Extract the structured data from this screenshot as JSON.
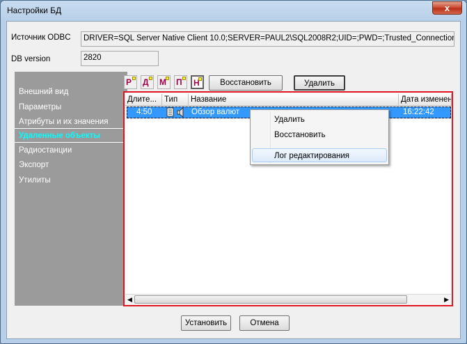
{
  "window": {
    "title": "Настройки БД",
    "close_glyph": "x"
  },
  "odbc": {
    "label": "Источник ODBC",
    "value": "DRIVER=SQL Server Native Client 10.0;SERVER=PAUL2\\SQL2008R2;UID=;PWD=;Trusted_Connection=yes;l"
  },
  "dbversion": {
    "label": "DB version",
    "value": "2820"
  },
  "nav": {
    "items": [
      {
        "label": "Внешний вид"
      },
      {
        "label": "Параметры"
      },
      {
        "label": "Атрибуты и их значения"
      },
      {
        "label": "Удаленные объекты",
        "selected": true
      },
      {
        "label": "Радиостанции"
      },
      {
        "label": "Экспорт"
      },
      {
        "label": "Утилиты"
      }
    ]
  },
  "toolbar": {
    "filters": [
      "Р",
      "Д",
      "М",
      "П",
      "Н"
    ],
    "restore_label": "Восстановить",
    "delete_label": "Удалить"
  },
  "grid": {
    "columns": [
      "Длите...",
      "Тип",
      "Название",
      "Дата изменен"
    ],
    "rows": [
      {
        "duration": "4:50",
        "name": "Обзор валют",
        "date": "16:22:42"
      }
    ]
  },
  "context_menu": {
    "items": [
      "Удалить",
      "Восстановить",
      "Лог редактирования"
    ]
  },
  "footer": {
    "ok_label": "Установить",
    "cancel_label": "Отмена"
  },
  "colors": {
    "accent_red": "#e0141e",
    "selection": "#3399ff",
    "nav_bg": "#9b9b9b",
    "nav_selected": "#00ffff"
  }
}
